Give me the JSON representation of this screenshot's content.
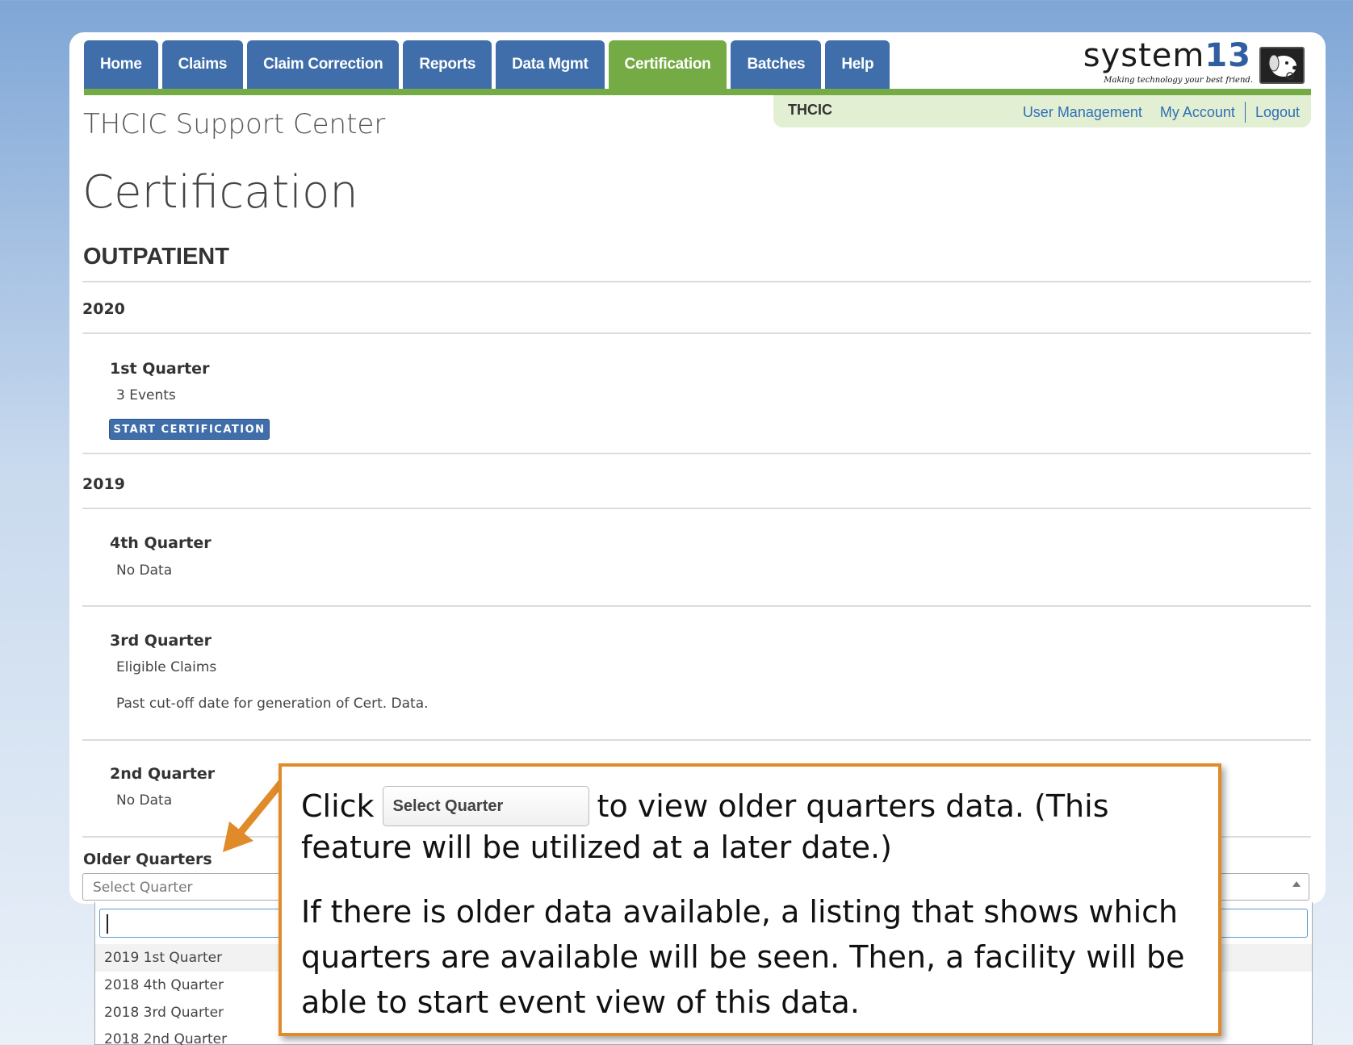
{
  "nav": {
    "tabs": [
      {
        "label": "Home"
      },
      {
        "label": "Claims"
      },
      {
        "label": "Claim Correction"
      },
      {
        "label": "Reports"
      },
      {
        "label": "Data Mgmt"
      },
      {
        "label": "Certification",
        "active": true
      },
      {
        "label": "Batches"
      },
      {
        "label": "Help"
      }
    ]
  },
  "logo": {
    "text_a": "system",
    "text_b": "13",
    "tagline": "Making technology your best friend."
  },
  "userbar": {
    "org": "THCIC",
    "user_management": "User Management",
    "my_account": "My Account",
    "logout": "Logout"
  },
  "site_title": "THCIC Support Center",
  "page_title": "Certification",
  "section_title": "OUTPATIENT",
  "years": [
    {
      "year": "2020",
      "quarters": [
        {
          "name": "1st Quarter",
          "info": "3 Events",
          "button": "START CERTIFICATION"
        }
      ]
    },
    {
      "year": "2019",
      "quarters": [
        {
          "name": "4th Quarter",
          "info": "No Data"
        },
        {
          "name": "3rd Quarter",
          "info": "Eligible Claims",
          "note": "Past cut-off date for generation of Cert. Data."
        },
        {
          "name": "2nd Quarter",
          "info": "No Data"
        }
      ]
    }
  ],
  "older": {
    "label": "Older Quarters",
    "placeholder": "Select Quarter",
    "options": [
      "2019 1st Quarter",
      "2018 4th Quarter",
      "2018 3rd Quarter",
      "2018 2nd Quarter"
    ]
  },
  "callout": {
    "click": "Click",
    "pill": "Select Quarter",
    "line1_rest": "to view older quarters data.  (This",
    "line2": "feature will be utilized at a later date.)",
    "para": "If there is older data available, a listing that shows which quarters are available will be seen.  Then, a facility will be able to start event view of this data."
  },
  "colors": {
    "nav_blue": "#3f6eaa",
    "nav_green": "#74ab44",
    "callout_border": "#e08a2a",
    "link_blue": "#2e6fb8"
  }
}
